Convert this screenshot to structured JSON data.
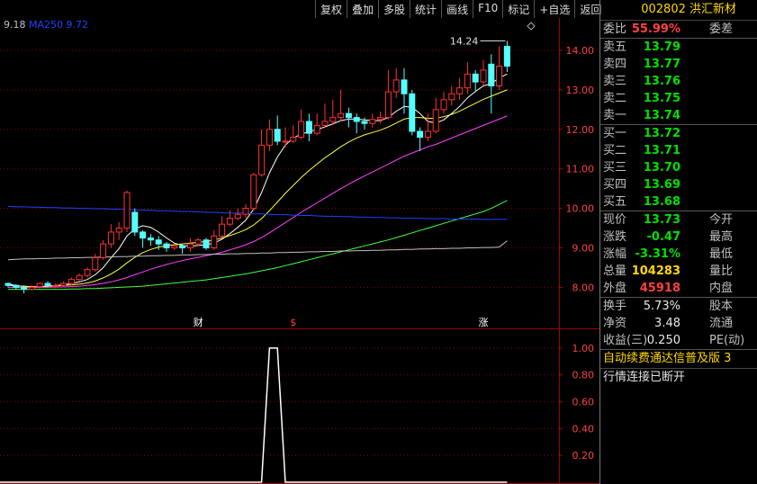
{
  "toolbar": [
    "复权",
    "叠加",
    "多股",
    "统计",
    "画线",
    "F10",
    "标记",
    "+自选",
    "返回"
  ],
  "legend": {
    "value1": "9.18",
    "ma_label": "MA250",
    "ma_value": "9.72"
  },
  "chart_data": {
    "type": "candlestick",
    "ylim": [
      7.6,
      14.5
    ],
    "y_ticks": [
      "14.00",
      "13.00",
      "12.00",
      "11.00",
      "10.00",
      "9.00",
      "8.00"
    ],
    "high_label": "14.24",
    "bars": [
      [
        8.1,
        8.05,
        8.12,
        8.0
      ],
      [
        8.05,
        8.0,
        8.08,
        7.95
      ],
      [
        8.0,
        7.95,
        8.05,
        7.85
      ],
      [
        7.95,
        8.0,
        8.05,
        7.92
      ],
      [
        8.02,
        8.1,
        8.12,
        7.98
      ],
      [
        8.1,
        8.05,
        8.15,
        8.0
      ],
      [
        8.05,
        8.05,
        8.1,
        7.98
      ],
      [
        8.05,
        8.1,
        8.15,
        8.0
      ],
      [
        8.1,
        8.2,
        8.25,
        8.05
      ],
      [
        8.2,
        8.3,
        8.35,
        8.15
      ],
      [
        8.3,
        8.45,
        8.5,
        8.25
      ],
      [
        8.45,
        8.75,
        8.85,
        8.4
      ],
      [
        8.75,
        9.1,
        9.2,
        8.7
      ],
      [
        9.1,
        9.4,
        9.6,
        9.0
      ],
      [
        9.4,
        9.5,
        9.65,
        9.2
      ],
      [
        9.5,
        10.4,
        10.45,
        9.4
      ],
      [
        9.9,
        9.4,
        10.0,
        9.3
      ],
      [
        9.4,
        9.25,
        9.45,
        9.0
      ],
      [
        9.25,
        9.2,
        9.35,
        9.05
      ],
      [
        9.2,
        9.1,
        9.3,
        8.95
      ],
      [
        9.1,
        9.0,
        9.15,
        8.9
      ],
      [
        9.0,
        9.05,
        9.1,
        8.95
      ],
      [
        9.05,
        9.0,
        9.1,
        8.85
      ],
      [
        9.0,
        9.1,
        9.25,
        8.9
      ],
      [
        9.1,
        9.2,
        9.25,
        9.05
      ],
      [
        9.2,
        9.0,
        9.25,
        8.95
      ],
      [
        9.0,
        9.3,
        9.45,
        8.95
      ],
      [
        9.3,
        9.6,
        9.8,
        9.25
      ],
      [
        9.6,
        9.75,
        9.95,
        9.55
      ],
      [
        9.75,
        9.85,
        10.0,
        9.7
      ],
      [
        9.85,
        10.0,
        10.1,
        9.75
      ],
      [
        10.0,
        10.85,
        10.9,
        9.95
      ],
      [
        10.85,
        11.6,
        12.0,
        10.8
      ],
      [
        11.6,
        12.0,
        12.25,
        11.45
      ],
      [
        12.0,
        11.7,
        12.35,
        11.6
      ],
      [
        11.7,
        11.7,
        12.05,
        11.55
      ],
      [
        11.7,
        11.8,
        12.1,
        11.65
      ],
      [
        11.8,
        12.2,
        12.5,
        11.75
      ],
      [
        12.2,
        11.9,
        12.4,
        11.7
      ],
      [
        11.9,
        12.1,
        12.4,
        11.85
      ],
      [
        12.1,
        12.2,
        12.65,
        12.05
      ],
      [
        12.2,
        12.3,
        12.75,
        12.1
      ],
      [
        12.3,
        12.4,
        13.0,
        12.2
      ],
      [
        12.4,
        12.3,
        12.55,
        12.05
      ],
      [
        12.3,
        12.2,
        12.4,
        11.9
      ],
      [
        12.2,
        12.15,
        12.3,
        12.0
      ],
      [
        12.15,
        12.25,
        12.4,
        12.05
      ],
      [
        12.25,
        12.3,
        12.45,
        12.15
      ],
      [
        12.3,
        12.95,
        13.5,
        12.25
      ],
      [
        12.95,
        13.25,
        13.55,
        12.8
      ],
      [
        13.25,
        12.9,
        13.55,
        12.4
      ],
      [
        12.9,
        11.95,
        13.0,
        11.85
      ],
      [
        11.95,
        11.8,
        12.05,
        11.45
      ],
      [
        11.8,
        11.95,
        12.4,
        11.7
      ],
      [
        11.95,
        12.5,
        12.8,
        11.9
      ],
      [
        12.5,
        12.75,
        12.95,
        12.4
      ],
      [
        12.75,
        12.9,
        13.1,
        12.6
      ],
      [
        12.9,
        13.05,
        13.3,
        12.75
      ],
      [
        13.05,
        13.4,
        13.7,
        12.9
      ],
      [
        13.4,
        13.2,
        13.5,
        12.95
      ],
      [
        13.2,
        13.5,
        13.75,
        13.1
      ],
      [
        13.65,
        13.1,
        13.9,
        12.4
      ],
      [
        13.1,
        13.6,
        14.1,
        13.0
      ],
      [
        14.1,
        13.6,
        14.24,
        13.45
      ]
    ],
    "ma_lines": [
      {
        "color": "#ffffff",
        "values": [
          8.08,
          8.05,
          8.02,
          8.0,
          8.01,
          8.03,
          8.05,
          8.06,
          8.1,
          8.14,
          8.2,
          8.32,
          8.5,
          8.75,
          8.98,
          9.3,
          9.48,
          9.56,
          9.52,
          9.4,
          9.25,
          9.12,
          9.06,
          9.04,
          9.06,
          9.08,
          9.12,
          9.22,
          9.36,
          9.52,
          9.7,
          9.98,
          10.4,
          10.9,
          11.3,
          11.6,
          11.78,
          11.88,
          11.94,
          12.0,
          12.06,
          12.14,
          12.22,
          12.26,
          12.26,
          12.24,
          12.22,
          12.22,
          12.3,
          12.46,
          12.58,
          12.56,
          12.4,
          12.2,
          12.16,
          12.24,
          12.4,
          12.58,
          12.8,
          12.96,
          13.1,
          13.16,
          13.3,
          13.4
        ]
      },
      {
        "color": "#ffff40",
        "values": [
          8.05,
          8.04,
          8.03,
          8.02,
          8.02,
          8.03,
          8.04,
          8.05,
          8.06,
          8.08,
          8.11,
          8.16,
          8.24,
          8.34,
          8.46,
          8.62,
          8.76,
          8.88,
          8.96,
          9.02,
          9.06,
          9.08,
          9.1,
          9.12,
          9.14,
          9.16,
          9.2,
          9.25,
          9.31,
          9.38,
          9.46,
          9.58,
          9.74,
          9.94,
          10.16,
          10.38,
          10.58,
          10.78,
          10.96,
          11.12,
          11.28,
          11.42,
          11.56,
          11.68,
          11.78,
          11.86,
          11.92,
          11.98,
          12.06,
          12.16,
          12.26,
          12.3,
          12.3,
          12.28,
          12.28,
          12.32,
          12.38,
          12.46,
          12.56,
          12.66,
          12.76,
          12.84,
          12.92,
          13.0
        ]
      },
      {
        "color": "#ff40ff",
        "values": [
          8.0,
          8.0,
          8.0,
          8.0,
          8.0,
          8.0,
          8.01,
          8.01,
          8.02,
          8.03,
          8.05,
          8.07,
          8.1,
          8.14,
          8.19,
          8.25,
          8.32,
          8.39,
          8.46,
          8.52,
          8.58,
          8.63,
          8.68,
          8.72,
          8.76,
          8.8,
          8.84,
          8.89,
          8.95,
          9.01,
          9.08,
          9.16,
          9.26,
          9.38,
          9.51,
          9.64,
          9.77,
          9.9,
          10.02,
          10.14,
          10.26,
          10.38,
          10.5,
          10.61,
          10.72,
          10.82,
          10.92,
          11.02,
          11.12,
          11.22,
          11.32,
          11.4,
          11.48,
          11.56,
          11.62,
          11.7,
          11.78,
          11.86,
          11.94,
          12.02,
          12.1,
          12.18,
          12.26,
          12.34
        ]
      },
      {
        "color": "#40ff40",
        "values": [
          7.95,
          7.95,
          7.95,
          7.95,
          7.95,
          7.95,
          7.95,
          7.95,
          7.96,
          7.96,
          7.97,
          7.97,
          7.98,
          7.99,
          8.0,
          8.01,
          8.02,
          8.03,
          8.05,
          8.07,
          8.09,
          8.11,
          8.13,
          8.15,
          8.17,
          8.19,
          8.22,
          8.25,
          8.28,
          8.31,
          8.34,
          8.38,
          8.42,
          8.46,
          8.5,
          8.55,
          8.6,
          8.65,
          8.7,
          8.75,
          8.8,
          8.85,
          8.9,
          8.95,
          9.0,
          9.05,
          9.1,
          9.15,
          9.2,
          9.26,
          9.32,
          9.38,
          9.44,
          9.5,
          9.56,
          9.62,
          9.68,
          9.74,
          9.8,
          9.86,
          9.92,
          10.0,
          10.1,
          10.2
        ]
      },
      {
        "color": "#c0c0c0",
        "values": [
          8.7,
          8.71,
          8.72,
          8.72,
          8.73,
          8.73,
          8.74,
          8.74,
          8.75,
          8.75,
          8.76,
          8.76,
          8.77,
          8.77,
          8.78,
          8.78,
          8.79,
          8.79,
          8.8,
          8.8,
          8.81,
          8.81,
          8.82,
          8.82,
          8.83,
          8.83,
          8.84,
          8.84,
          8.85,
          8.85,
          8.86,
          8.86,
          8.87,
          8.87,
          8.88,
          8.88,
          8.89,
          8.89,
          8.9,
          8.9,
          8.91,
          8.91,
          8.92,
          8.92,
          8.93,
          8.93,
          8.94,
          8.94,
          8.95,
          8.95,
          8.96,
          8.96,
          8.97,
          8.97,
          8.98,
          8.98,
          8.99,
          8.99,
          9.0,
          9.0,
          9.01,
          9.01,
          9.02,
          9.18
        ]
      },
      {
        "color": "#2040ff",
        "values": [
          10.05,
          10.04,
          10.04,
          10.03,
          10.03,
          10.02,
          10.02,
          10.01,
          10.01,
          10.0,
          10.0,
          9.99,
          9.99,
          9.98,
          9.98,
          9.97,
          9.96,
          9.96,
          9.95,
          9.94,
          9.94,
          9.93,
          9.92,
          9.92,
          9.91,
          9.9,
          9.9,
          9.89,
          9.88,
          9.88,
          9.87,
          9.86,
          9.86,
          9.85,
          9.84,
          9.84,
          9.83,
          9.82,
          9.82,
          9.81,
          9.8,
          9.8,
          9.79,
          9.79,
          9.78,
          9.78,
          9.77,
          9.77,
          9.76,
          9.76,
          9.75,
          9.75,
          9.75,
          9.74,
          9.74,
          9.74,
          9.73,
          9.73,
          9.73,
          9.73,
          9.72,
          9.72,
          9.72,
          9.72
        ]
      }
    ],
    "markers": [
      {
        "text": "财",
        "bar": 24,
        "color": "#ffffff"
      },
      {
        "text": "$",
        "bar": 36,
        "color": "#ff4040"
      },
      {
        "text": "涨",
        "bar": 60,
        "color": "#ffffff"
      }
    ],
    "indicator": {
      "y_ticks": [
        "1.00",
        "0.80",
        "0.60",
        "0.40",
        "0.20"
      ],
      "ylim": [
        0,
        1.1
      ],
      "values_pulse": [
        0,
        0,
        0,
        0,
        0,
        0,
        0,
        0,
        0,
        0,
        0,
        0,
        0,
        0,
        0,
        0,
        0,
        0,
        0,
        0,
        0,
        0,
        0,
        0,
        0,
        0,
        0,
        0,
        0,
        0,
        0,
        0,
        0,
        1,
        1,
        0,
        0,
        0,
        0,
        0,
        0,
        0,
        0,
        0,
        0,
        0,
        0,
        0,
        0,
        0,
        0,
        0,
        0,
        0,
        0,
        0,
        0,
        0,
        0,
        0,
        0,
        0,
        0,
        0
      ]
    }
  },
  "panel": {
    "title": "002802 洪汇新材",
    "weibi": {
      "label": "委比",
      "value": "55.99%",
      "label2": "委差"
    },
    "sells": [
      {
        "label": "卖五",
        "price": "13.79"
      },
      {
        "label": "卖四",
        "price": "13.77"
      },
      {
        "label": "卖三",
        "price": "13.76"
      },
      {
        "label": "卖二",
        "price": "13.75"
      },
      {
        "label": "卖一",
        "price": "13.74"
      }
    ],
    "buys": [
      {
        "label": "买一",
        "price": "13.72"
      },
      {
        "label": "买二",
        "price": "13.71"
      },
      {
        "label": "买三",
        "price": "13.70"
      },
      {
        "label": "买四",
        "price": "13.69"
      },
      {
        "label": "买五",
        "price": "13.68"
      }
    ],
    "quote": [
      {
        "label": "现价",
        "value": "13.73",
        "cls": "green",
        "label2": "今开"
      },
      {
        "label": "涨跌",
        "value": "-0.47",
        "cls": "green",
        "label2": "最高"
      },
      {
        "label": "涨幅",
        "value": "-3.31%",
        "cls": "green",
        "label2": "最低"
      },
      {
        "label": "总量",
        "value": "104283",
        "cls": "yellow",
        "label2": "量比"
      },
      {
        "label": "外盘",
        "value": "45918",
        "cls": "red",
        "label2": "内盘"
      }
    ],
    "fin": [
      {
        "label": "换手",
        "value": "5.73%",
        "label2": "股本"
      },
      {
        "label": "净资",
        "value": "3.48",
        "label2": "流通"
      },
      {
        "label": "收益(三)",
        "value": "0.250",
        "label2": "PE(动)"
      }
    ],
    "notice": "自动续费通达信普及版 3",
    "status": "行情连接已断开"
  }
}
